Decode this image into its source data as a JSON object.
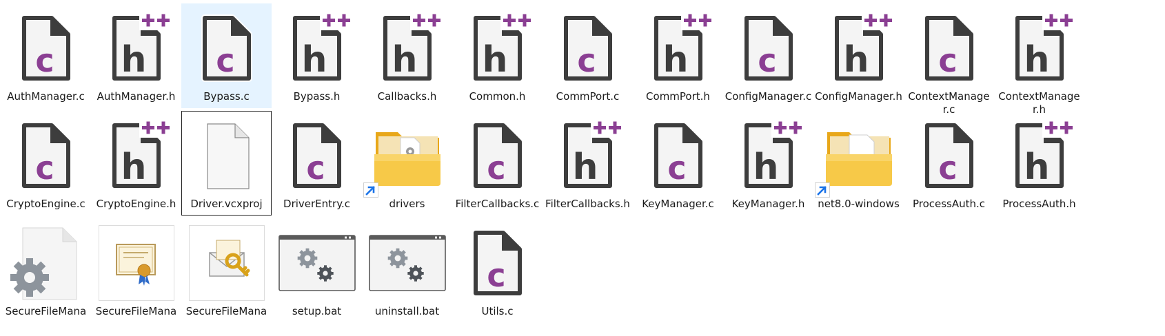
{
  "files": [
    {
      "name": "AuthManager.c",
      "type": "c"
    },
    {
      "name": "AuthManager.h",
      "type": "h"
    },
    {
      "name": "Bypass.c",
      "type": "c",
      "selected": true
    },
    {
      "name": "Bypass.h",
      "type": "h"
    },
    {
      "name": "Callbacks.h",
      "type": "h"
    },
    {
      "name": "Common.h",
      "type": "h"
    },
    {
      "name": "CommPort.c",
      "type": "c"
    },
    {
      "name": "CommPort.h",
      "type": "h"
    },
    {
      "name": "ConfigManager.c",
      "type": "c"
    },
    {
      "name": "ConfigManager.h",
      "type": "h"
    },
    {
      "name": "ContextManager.c",
      "type": "c"
    },
    {
      "name": "ContextManager.h",
      "type": "h"
    },
    {
      "name": "CryptoEngine.c",
      "type": "c"
    },
    {
      "name": "CryptoEngine.h",
      "type": "h"
    },
    {
      "name": "Driver.vcxproj",
      "type": "blank",
      "focused": true
    },
    {
      "name": "DriverEntry.c",
      "type": "c"
    },
    {
      "name": "drivers",
      "type": "folder-gear",
      "shortcut": true
    },
    {
      "name": "FilterCallbacks.c",
      "type": "c"
    },
    {
      "name": "FilterCallbacks.h",
      "type": "h"
    },
    {
      "name": "KeyManager.c",
      "type": "c"
    },
    {
      "name": "KeyManager.h",
      "type": "h"
    },
    {
      "name": "net8.0-windows",
      "type": "folder-doc",
      "shortcut": true
    },
    {
      "name": "ProcessAuth.c",
      "type": "c"
    },
    {
      "name": "ProcessAuth.h",
      "type": "h"
    },
    {
      "name": "SecureFileMana",
      "type": "exe-gear"
    },
    {
      "name": "SecureFileMana",
      "type": "cert"
    },
    {
      "name": "SecureFileMana",
      "type": "cert-key"
    },
    {
      "name": "setup.bat",
      "type": "bat"
    },
    {
      "name": "uninstall.bat",
      "type": "bat"
    },
    {
      "name": "Utils.c",
      "type": "c"
    }
  ],
  "colors": {
    "accent_purple": "#8b3f93",
    "doc_dark": "#3d3d3d",
    "selection": "#e5f3ff",
    "folder": "#f7c948",
    "shortcut_arrow": "#1a73e8"
  },
  "icons": {
    "c": "c-source-file-icon",
    "h": "cpp-header-file-icon",
    "blank": "blank-file-icon",
    "folder-gear": "folder-icon",
    "folder-doc": "folder-icon",
    "exe-gear": "settings-file-icon",
    "cert": "certificate-icon",
    "cert-key": "certificate-key-icon",
    "bat": "batch-file-icon"
  }
}
